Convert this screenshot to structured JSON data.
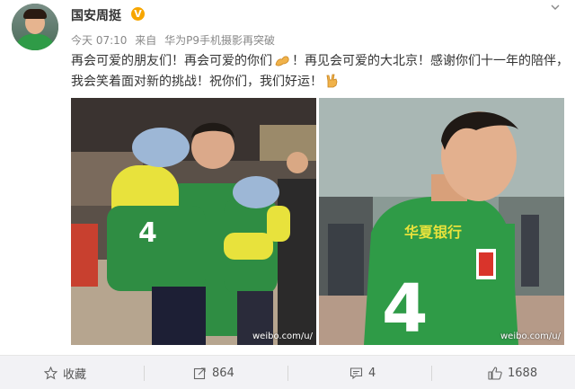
{
  "post": {
    "username": "国安周挺",
    "verified_badge": "V",
    "time": "今天 07:10",
    "source_prefix": "来自",
    "source": "华为P9手机摄影再突破",
    "text_part1": "再会可爱的朋友们！再会可爱的你们",
    "text_part2": "！再见会可爱的大北京！感谢你们十一年的陪伴，我会笑着面对新的挑战！祝你们，我们好运！",
    "emoji_1": "muscle-emoji",
    "emoji_2": "rock-hand-emoji",
    "watermark_1": "weibo.com/u/",
    "watermark_2": "weibo.com/u/",
    "photo2_jersey_text": "华夏银行",
    "photo2_jersey_number": "4",
    "photo1_jersey_number": "4"
  },
  "actions": {
    "favorite_label": "收藏",
    "repost_count": "864",
    "comment_count": "4",
    "like_count": "1688"
  },
  "colors": {
    "accent_orange": "#f7a600",
    "jersey_green": "#2f9b47",
    "action_bar_bg": "#f2f2f5"
  }
}
